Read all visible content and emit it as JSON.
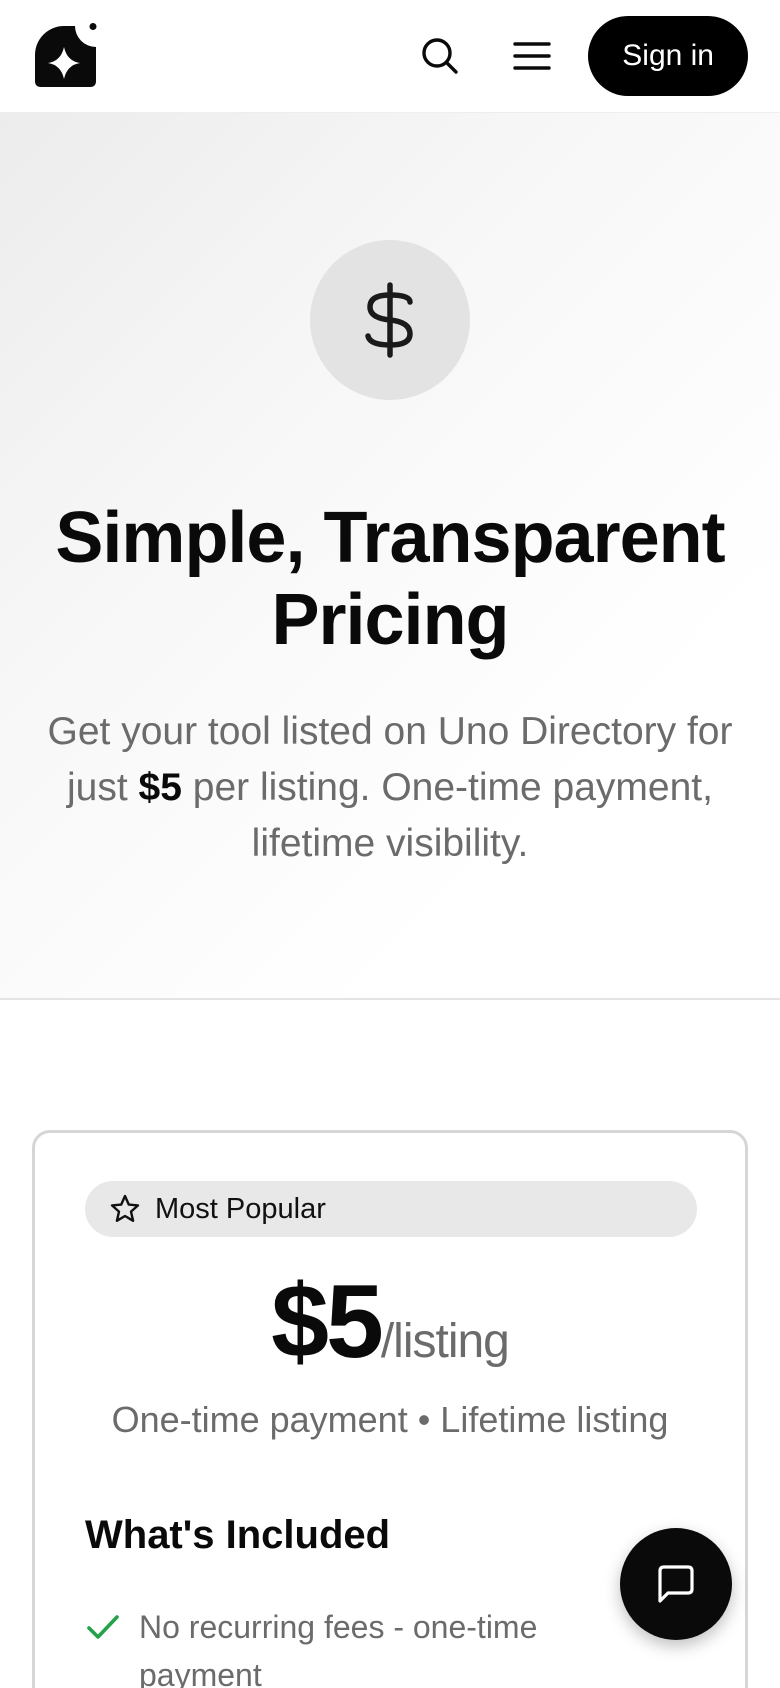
{
  "header": {
    "logo_icon": "sparkle-app-logo-icon",
    "search_icon": "search-icon",
    "menu_icon": "hamburger-menu-icon",
    "signin_label": "Sign in"
  },
  "hero": {
    "icon": "dollar-sign-icon",
    "title_line1": "Simple, Transparent",
    "title_line2": "Pricing",
    "subtitle_prefix": "Get your tool listed on Uno Directory for just ",
    "subtitle_price": "$5",
    "subtitle_suffix": " per listing. One-time payment, lifetime visibility."
  },
  "pricing_card": {
    "badge_icon": "star-outline-icon",
    "badge_label": "Most Popular",
    "price": "$5",
    "per": "/listing",
    "note": "One-time payment • Lifetime listing",
    "included_title": "What's Included",
    "features": [
      {
        "icon": "check-icon",
        "text": "No recurring fees - one-time payment"
      }
    ]
  },
  "chat": {
    "icon": "chat-bubble-icon"
  },
  "colors": {
    "accent": "#000000",
    "check": "#22a24a",
    "muted": "#6b6b6b"
  }
}
